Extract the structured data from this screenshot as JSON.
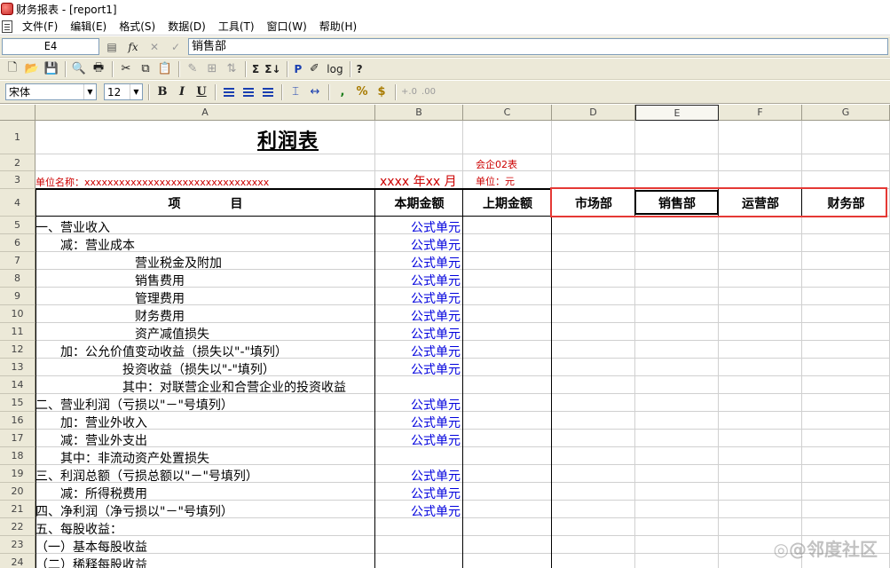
{
  "window": {
    "title": "财务报表 - [report1]"
  },
  "menu": [
    "文件(F)",
    "编辑(E)",
    "格式(S)",
    "数据(D)",
    "工具(T)",
    "窗口(W)",
    "帮助(H)"
  ],
  "formula_bar": {
    "cell_ref": "E4",
    "fx": "fx",
    "value": "销售部"
  },
  "toolbar_format": {
    "font": "宋体",
    "size": "12",
    "bold": "B",
    "italic": "I",
    "underline": "U",
    "comma": ",",
    "percent": "%",
    "currency": "$"
  },
  "toolbar_labels": {
    "sum1": "Σ",
    "sum2": "Σ↓",
    "p": "P",
    "log": "log",
    "help": "?"
  },
  "sheet": {
    "columns": [
      "A",
      "B",
      "C",
      "D",
      "E",
      "F",
      "G"
    ],
    "rows": [
      "1",
      "2",
      "3",
      "4",
      "5",
      "6",
      "7",
      "8",
      "9",
      "10",
      "11",
      "12",
      "13",
      "14",
      "15",
      "16",
      "17",
      "18",
      "19",
      "20",
      "21",
      "22",
      "23",
      "24"
    ],
    "title": "利润表",
    "form_no": "会企02表",
    "unit_name": "单位名称：xxxxxxxxxxxxxxxxxxxxxxxxxxxxxxxx",
    "period": "xxxx 年xx 月",
    "unit": "单位：元",
    "headers": [
      "项　　　　目",
      "本期金额",
      "上期金额",
      "市场部",
      "销售部",
      "运营部",
      "财务部"
    ],
    "items": [
      {
        "label": "一、营业收入",
        "formula": "公式单元"
      },
      {
        "label": "　　减：营业成本",
        "formula": "公式单元"
      },
      {
        "label": "　　　　　　　　营业税金及附加",
        "formula": "公式单元"
      },
      {
        "label": "　　　　　　　　销售费用",
        "formula": "公式单元"
      },
      {
        "label": "　　　　　　　　管理费用",
        "formula": "公式单元"
      },
      {
        "label": "　　　　　　　　财务费用",
        "formula": "公式单元"
      },
      {
        "label": "　　　　　　　　资产减值损失",
        "formula": "公式单元"
      },
      {
        "label": "　　加：公允价值变动收益（损失以\"-\"填列）",
        "formula": "公式单元"
      },
      {
        "label": "　　　　　　　投资收益（损失以\"-\"填列）",
        "formula": "公式单元"
      },
      {
        "label": "　　　　　　　其中：对联营企业和合营企业的投资收益",
        "formula": ""
      },
      {
        "label": "二、营业利润（亏损以\"－\"号填列）",
        "formula": "公式单元"
      },
      {
        "label": "　　加：营业外收入",
        "formula": "公式单元"
      },
      {
        "label": "　　减：营业外支出",
        "formula": "公式单元"
      },
      {
        "label": "　　其中：非流动资产处置损失",
        "formula": ""
      },
      {
        "label": "三、利润总额（亏损总额以\"－\"号填列）",
        "formula": "公式单元"
      },
      {
        "label": "　　减：所得税费用",
        "formula": "公式单元"
      },
      {
        "label": "四、净利润（净亏损以\"－\"号填列）",
        "formula": "公式单元"
      },
      {
        "label": "五、每股收益：",
        "formula": ""
      },
      {
        "label": "（一）基本每股收益",
        "formula": ""
      },
      {
        "label": "（二）稀释每股收益",
        "formula": ""
      }
    ]
  },
  "watermark": "◎@邻度社区",
  "colors": {
    "highlight_border": "#e53935",
    "formula_text": "#0000dd",
    "label_red": "#cc0000"
  }
}
